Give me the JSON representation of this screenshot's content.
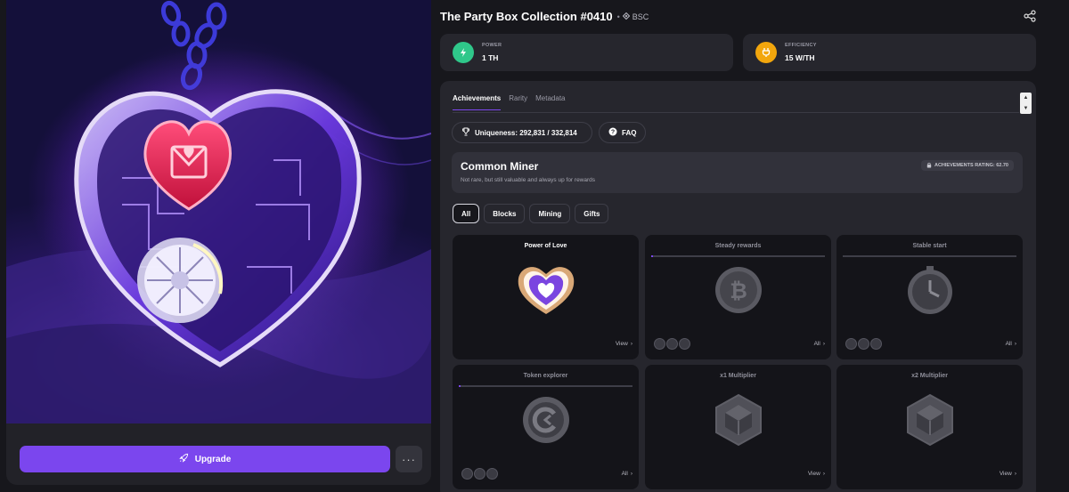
{
  "title": "The Party Box Collection #0410",
  "chain": "BSC",
  "actions": {
    "upgrade_label": "Upgrade",
    "more_label": "···"
  },
  "stats": [
    {
      "label": "POWER",
      "value": "1 TH",
      "color": "#2fc78a"
    },
    {
      "label": "EFFICIENCY",
      "value": "15 W/TH",
      "color": "#f2a60d"
    }
  ],
  "tabs": [
    {
      "label": "Achievements",
      "active": true
    },
    {
      "label": "Rarity"
    },
    {
      "label": "Metadata"
    }
  ],
  "uniqueness": "Uniqueness: 292,831 / 332,814",
  "faq_label": "FAQ",
  "rarity": {
    "title": "Common Miner",
    "description": "Not rare, but still valuable and always up for rewards",
    "rating": "ACHIEVEMENTS RATING: 62.70"
  },
  "filters": [
    {
      "label": "All",
      "active": true
    },
    {
      "label": "Blocks"
    },
    {
      "label": "Mining"
    },
    {
      "label": "Gifts"
    }
  ],
  "achievements": [
    {
      "title": "Power of Love",
      "earned": true,
      "link": "View",
      "icon": "heart-badge-icon"
    },
    {
      "title": "Steady rewards",
      "earned": false,
      "progress": 0.01,
      "link": "All",
      "icon": "bitcoin-coin-icon"
    },
    {
      "title": "Stable start",
      "earned": false,
      "progress": 0.0,
      "link": "All",
      "icon": "stopwatch-icon"
    },
    {
      "title": "Token explorer",
      "earned": false,
      "progress": 0.01,
      "link": "All",
      "icon": "token-coin-icon"
    },
    {
      "title": "x1 Multiplier",
      "earned": false,
      "link": "View",
      "icon": "cube-hexagon-icon"
    },
    {
      "title": "x2 Multiplier",
      "earned": false,
      "link": "View",
      "icon": "cube-hexagon-icon"
    }
  ]
}
